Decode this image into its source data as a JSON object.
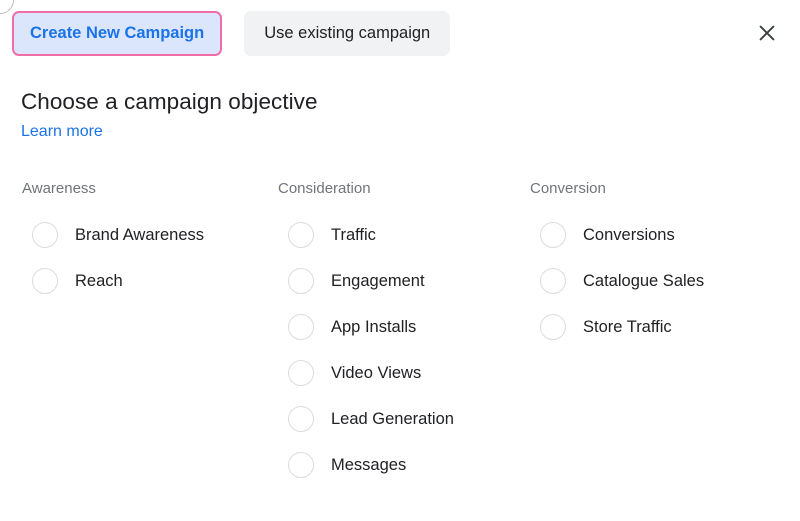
{
  "dialog": {
    "close_icon": "close-icon"
  },
  "tabs": [
    {
      "label": "Create New Campaign",
      "state": "selected"
    },
    {
      "label": "Use existing campaign",
      "state": "unselected"
    }
  ],
  "header": {
    "title": "Choose a campaign objective",
    "learn_more_label": "Learn more"
  },
  "columns": [
    {
      "header": "Awareness",
      "options": [
        {
          "label": "Brand Awareness",
          "selected": false
        },
        {
          "label": "Reach",
          "selected": false
        }
      ]
    },
    {
      "header": "Consideration",
      "options": [
        {
          "label": "Traffic",
          "selected": false
        },
        {
          "label": "Engagement",
          "selected": false
        },
        {
          "label": "App Installs",
          "selected": false
        },
        {
          "label": "Video Views",
          "selected": false
        },
        {
          "label": "Lead Generation",
          "selected": false
        },
        {
          "label": "Messages",
          "selected": false
        }
      ]
    },
    {
      "header": "Conversion",
      "options": [
        {
          "label": "Conversions",
          "selected": false
        },
        {
          "label": "Catalogue Sales",
          "selected": false
        },
        {
          "label": "Store Traffic",
          "selected": false
        }
      ]
    }
  ],
  "colors": {
    "tab_selected_bg": "#dbe6fd",
    "tab_selected_border": "#ef6ea9",
    "tab_selected_text": "#1a73e8",
    "tab_unselected_bg": "#f1f2f4",
    "link": "#1a73e8",
    "text_primary": "#202124",
    "text_secondary": "#70757a",
    "radio_border": "#dadce0"
  }
}
